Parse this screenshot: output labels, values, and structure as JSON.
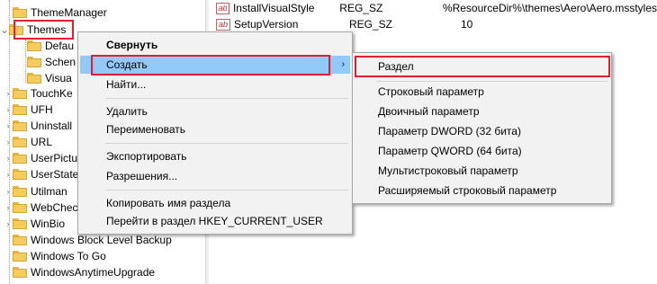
{
  "tree": [
    {
      "label": "ThemeManager",
      "chev": ""
    },
    {
      "label": "Themes",
      "chev": "⌄"
    },
    {
      "label": "Defau",
      "chev": ""
    },
    {
      "label": "Schen",
      "chev": ""
    },
    {
      "label": "Visua",
      "chev": ""
    },
    {
      "label": "TouchKe",
      "chev": "›"
    },
    {
      "label": "UFH",
      "chev": "›"
    },
    {
      "label": "Uninstall",
      "chev": "›"
    },
    {
      "label": "URL",
      "chev": "›"
    },
    {
      "label": "UserPictu",
      "chev": "›"
    },
    {
      "label": "UserState",
      "chev": "›"
    },
    {
      "label": "Utilman",
      "chev": "›"
    },
    {
      "label": "WebChec",
      "chev": "›"
    },
    {
      "label": "WinBio",
      "chev": "›"
    },
    {
      "label": "Windows Block Level Backup",
      "chev": ""
    },
    {
      "label": "Windows To Go",
      "chev": ""
    },
    {
      "label": "WindowsAnytimeUpgrade",
      "chev": ""
    }
  ],
  "values": [
    {
      "name": "InstallVisualStyle",
      "type": "REG_SZ",
      "data": "%ResourceDir%\\themes\\Aero\\Aero.msstyles",
      "icon": "ab"
    },
    {
      "name": "SetupVersion",
      "type": "REG_SZ",
      "data": "10",
      "icon": "ab"
    }
  ],
  "context_menu": {
    "collapse": "Свернуть",
    "create": "Создать",
    "find": "Найти...",
    "delete": "Удалить",
    "rename": "Переименовать",
    "export": "Экспортировать",
    "permissions": "Разрешения...",
    "copy_key_name": "Копировать имя раздела",
    "goto_hkcu": "Перейти в раздел HKEY_CURRENT_USER",
    "submenu_arrow": "›"
  },
  "submenu": {
    "key": "Раздел",
    "string": "Строковый параметр",
    "binary": "Двоичный параметр",
    "dword": "Параметр DWORD (32 бита)",
    "qword": "Параметр QWORD (64 бита)",
    "multi_string": "Мультистроковый параметр",
    "expandable_string": "Расширяемый строковый параметр"
  },
  "colors": {
    "highlight_red": "#e0202b",
    "hover_blue": "#91c9f7",
    "folder": "#f4cb5e"
  }
}
